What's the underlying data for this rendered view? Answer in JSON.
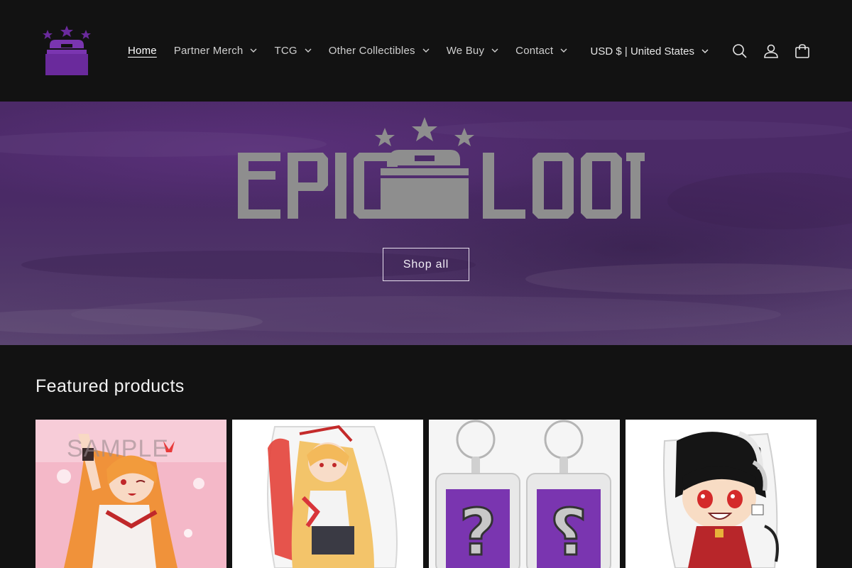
{
  "header": {
    "logo_icon": "epic-loot-chest-icon",
    "nav": [
      {
        "label": "Home",
        "active": true,
        "has_dropdown": false
      },
      {
        "label": "Partner Merch",
        "active": false,
        "has_dropdown": true
      },
      {
        "label": "TCG",
        "active": false,
        "has_dropdown": true
      },
      {
        "label": "Other Collectibles",
        "active": false,
        "has_dropdown": true
      },
      {
        "label": "We Buy",
        "active": false,
        "has_dropdown": true
      },
      {
        "label": "Contact",
        "active": false,
        "has_dropdown": true
      }
    ],
    "currency_label": "USD $ | United States",
    "icons": [
      "search-icon",
      "account-icon",
      "cart-icon"
    ]
  },
  "hero": {
    "logo_text": "EPIC LOOT",
    "button_label": "Shop all"
  },
  "featured": {
    "title": "Featured products",
    "watermark_text": "SAMPLE",
    "products": [
      {
        "image": "anime-girl-print-pink-background"
      },
      {
        "image": "anime-girl-acrylic-charm"
      },
      {
        "image": "mystery-keychain-pair"
      },
      {
        "image": "chibi-boy-acrylic-charm"
      }
    ]
  },
  "colors": {
    "background": "#121212",
    "brand_purple": "#6a2a9c",
    "hero_purple": "#4c2a68",
    "logo_gray": "#8c8c8c"
  }
}
